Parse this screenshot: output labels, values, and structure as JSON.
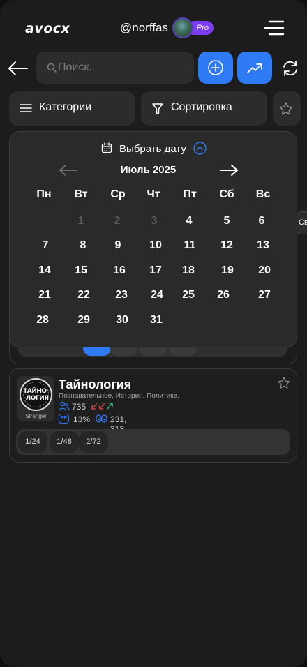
{
  "header": {
    "logo": "avocx",
    "username": "@norffas",
    "badge": "Pro"
  },
  "search": {
    "placeholder": "Поиск.."
  },
  "filters": {
    "categories_label": "Категории",
    "sort_label": "Сортировка"
  },
  "side_chip": {
    "label": "Све"
  },
  "calendar": {
    "header_label": "Выбрать дату",
    "month": "Июль 2025",
    "weekdays": [
      "Пн",
      "Вт",
      "Ср",
      "Чт",
      "Пт",
      "Сб",
      "Вс"
    ],
    "weeks": [
      [
        "1",
        "2",
        "3",
        "4",
        "5",
        "6"
      ],
      [
        "7",
        "8",
        "9",
        "10",
        "11",
        "12",
        "13"
      ],
      [
        "14",
        "15",
        "16",
        "17",
        "18",
        "19",
        "20"
      ],
      [
        "21",
        "22",
        "23",
        "24",
        "25",
        "26",
        "27"
      ],
      [
        "28",
        "29",
        "30",
        "31"
      ]
    ],
    "muted_days": [
      "1",
      "2",
      "3"
    ]
  },
  "channel": {
    "name": "Тайнология",
    "description": "Познавательное, История, Политика.",
    "logo_text": "ТАЙНО-\n-ЛОГИЯ",
    "category": "Stranger",
    "subscribers": "735",
    "er_label": "ER",
    "er_value": "13%",
    "views": "231, 313, 420",
    "pills": [
      "1/24",
      "1/48",
      "2/72"
    ]
  },
  "colors": {
    "accent": "#2f7bf5",
    "pro_badge": "#7a3df0",
    "trend_up": "#3fd08a",
    "trend_down": "#e64848"
  }
}
